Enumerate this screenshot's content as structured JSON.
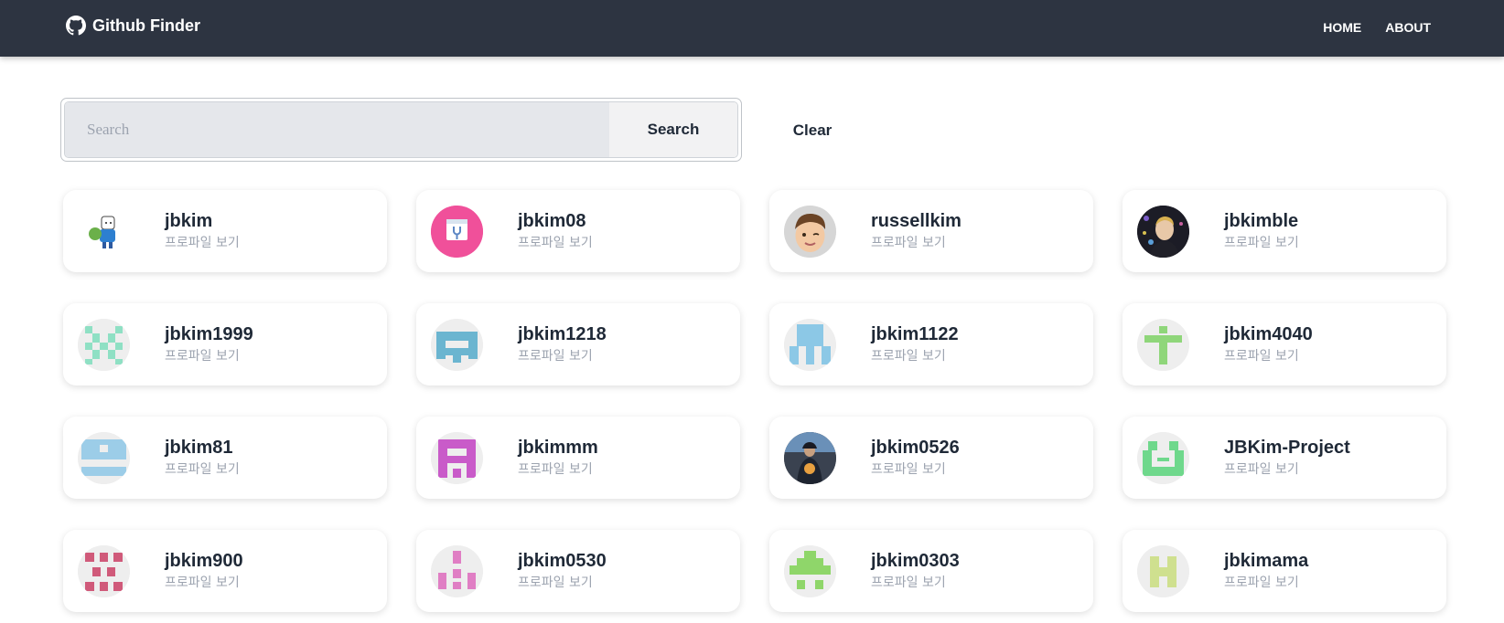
{
  "nav": {
    "brand": "Github Finder",
    "brand_icon": "github-icon",
    "links": [
      "HOME",
      "ABOUT"
    ]
  },
  "search": {
    "placeholder": "Search",
    "value": "",
    "button_label": "Search",
    "clear_label": "Clear"
  },
  "users": [
    {
      "username": "jbkim",
      "subtitle": "프로파일 보기",
      "avatar": "cartoon-avatar-icon"
    },
    {
      "username": "jbkim08",
      "subtitle": "프로파일 보기",
      "avatar": "pink-logo-avatar-icon"
    },
    {
      "username": "russellkim",
      "subtitle": "프로파일 보기",
      "avatar": "memoji-avatar-icon"
    },
    {
      "username": "jbkimble",
      "subtitle": "프로파일 보기",
      "avatar": "photo-avatar-icon"
    },
    {
      "username": "jbkim1999",
      "subtitle": "프로파일 보기",
      "avatar": "identicon-icon",
      "color": "#8fe0c4"
    },
    {
      "username": "jbkim1218",
      "subtitle": "프로파일 보기",
      "avatar": "identicon-icon",
      "color": "#6bb5d0"
    },
    {
      "username": "jbkim1122",
      "subtitle": "프로파일 보기",
      "avatar": "identicon-icon",
      "color": "#8cc8e6"
    },
    {
      "username": "jbkim4040",
      "subtitle": "프로파일 보기",
      "avatar": "identicon-icon",
      "color": "#8fd67a"
    },
    {
      "username": "jbkim81",
      "subtitle": "프로파일 보기",
      "avatar": "identicon-icon",
      "color": "#9ccde8"
    },
    {
      "username": "jbkimmm",
      "subtitle": "프로파일 보기",
      "avatar": "identicon-icon",
      "color": "#c95bc9"
    },
    {
      "username": "jbkim0526",
      "subtitle": "프로파일 보기",
      "avatar": "photo-avatar-icon"
    },
    {
      "username": "JBKim-Project",
      "subtitle": "프로파일 보기",
      "avatar": "identicon-icon",
      "color": "#6fd88c"
    },
    {
      "username": "jbkim900",
      "subtitle": "프로파일 보기",
      "avatar": "identicon-icon",
      "color": "#d05a7a"
    },
    {
      "username": "jbkim0530",
      "subtitle": "프로파일 보기",
      "avatar": "identicon-icon",
      "color": "#e07ec4"
    },
    {
      "username": "jbkim0303",
      "subtitle": "프로파일 보기",
      "avatar": "identicon-icon",
      "color": "#8fd66a"
    },
    {
      "username": "jbkimama",
      "subtitle": "프로파일 보기",
      "avatar": "identicon-icon",
      "color": "#cfe08f"
    }
  ]
}
